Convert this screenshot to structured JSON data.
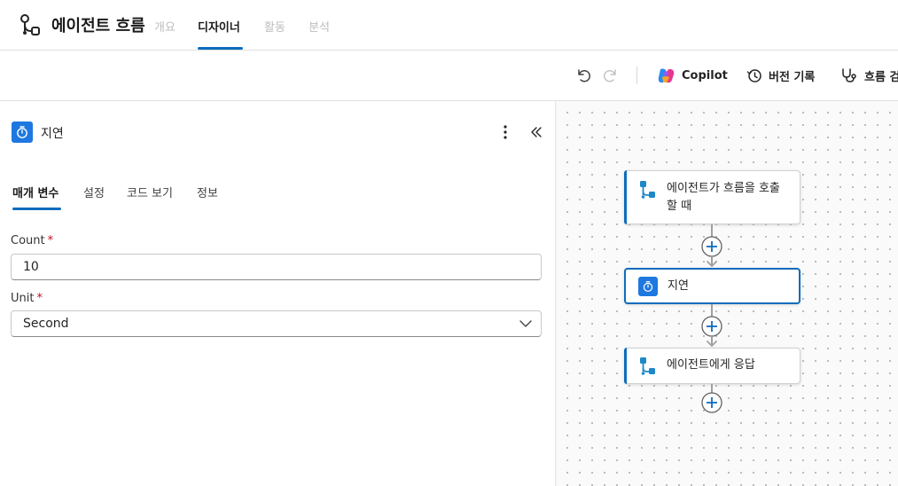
{
  "header": {
    "title": "에이전트 흐름",
    "tabs": [
      {
        "label": "개요",
        "state": "disabled"
      },
      {
        "label": "디자이너",
        "state": "active"
      },
      {
        "label": "활동",
        "state": "disabled"
      },
      {
        "label": "분석",
        "state": "disabled"
      }
    ]
  },
  "toolbar": {
    "copilot_label": "Copilot",
    "version_history_label": "버전 기록",
    "flow_checker_label": "흐름 검"
  },
  "panel": {
    "title": "지연",
    "tabs": [
      "매개 변수",
      "설정",
      "코드 보기",
      "정보"
    ],
    "fields": {
      "count": {
        "label": "Count",
        "required_mark": "*",
        "value": "10"
      },
      "unit": {
        "label": "Unit",
        "required_mark": "*",
        "value": "Second"
      }
    }
  },
  "flow": {
    "nodes": [
      {
        "line1": "에이전트가 흐름을 호출",
        "line2": "할 때"
      },
      {
        "line1": "지연"
      },
      {
        "line1": "에이전트에게 응답"
      }
    ]
  },
  "colors": {
    "accent": "#0f6cbd",
    "timer_icon_bg": "#1e78e0",
    "required": "#c50f1f"
  }
}
